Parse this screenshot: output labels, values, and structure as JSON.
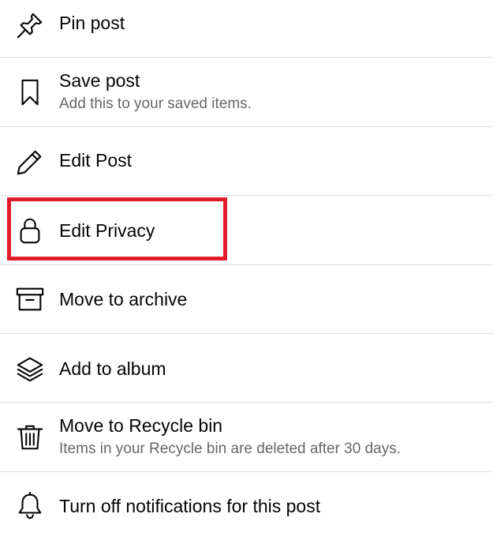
{
  "menu": {
    "items": [
      {
        "label": "Pin post",
        "icon": "pin-icon"
      },
      {
        "label": "Save post",
        "sub": "Add this to your saved items.",
        "icon": "bookmark-icon"
      },
      {
        "label": "Edit Post",
        "icon": "pencil-icon"
      },
      {
        "label": "Edit Privacy",
        "icon": "lock-icon"
      },
      {
        "label": "Move to archive",
        "icon": "archive-icon"
      },
      {
        "label": "Add to album",
        "icon": "layers-icon"
      },
      {
        "label": "Move to Recycle bin",
        "sub": "Items in your Recycle bin are deleted after 30 days.",
        "icon": "trash-icon"
      },
      {
        "label": "Turn off notifications for this post",
        "icon": "bell-icon"
      }
    ],
    "highlight_color": "#e21d2b"
  }
}
